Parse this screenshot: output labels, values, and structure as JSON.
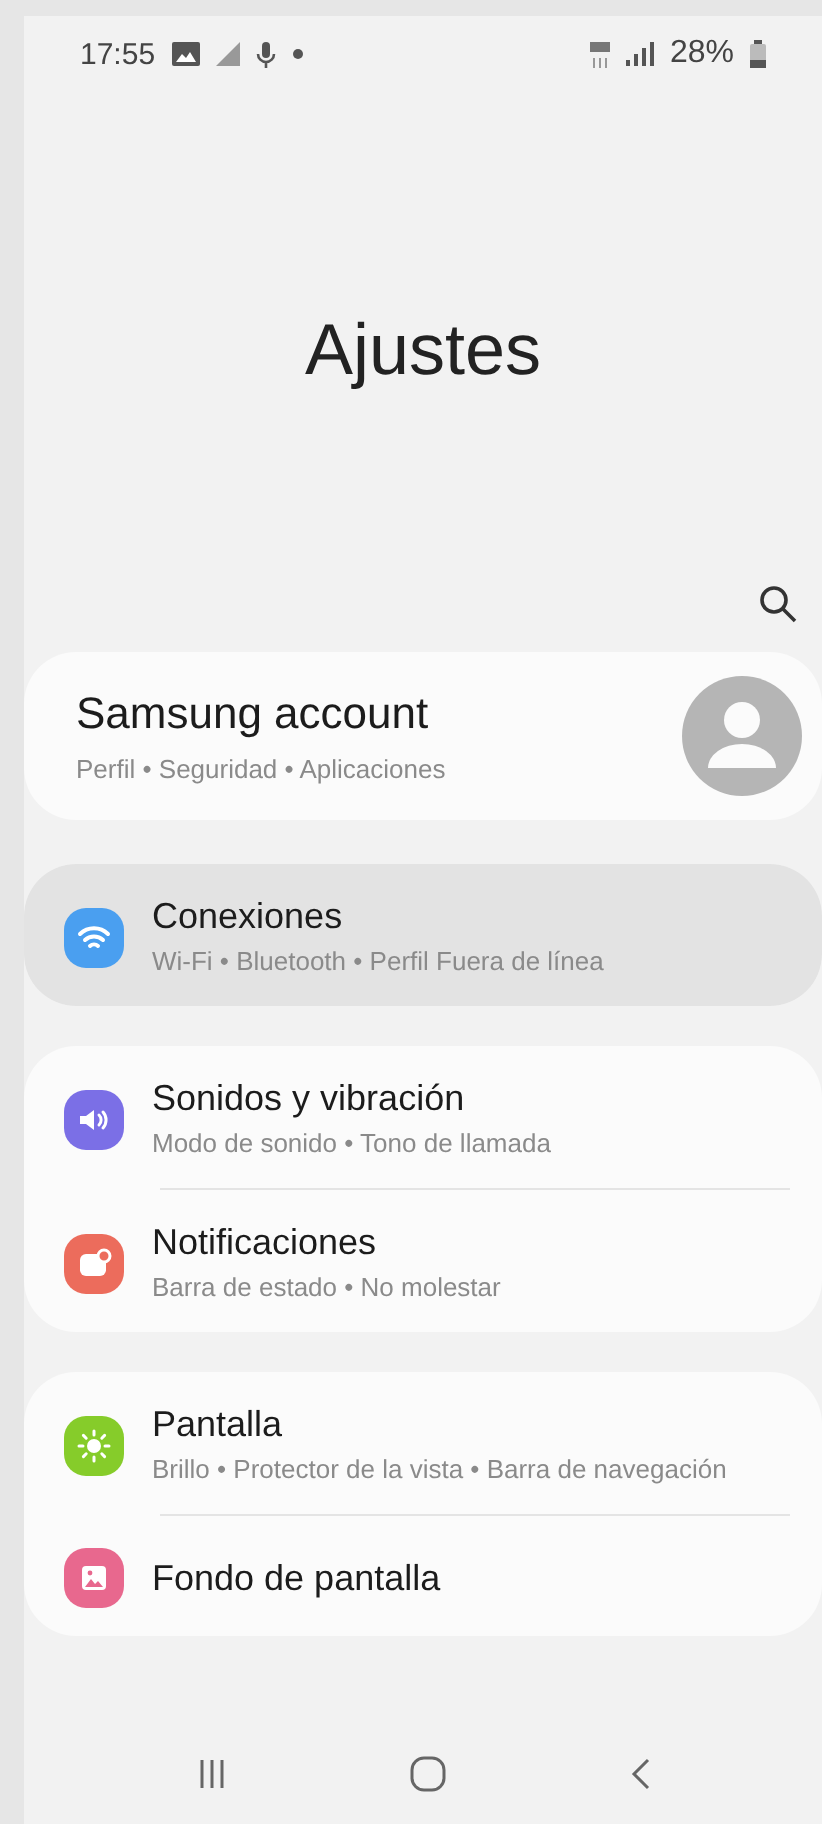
{
  "status_bar": {
    "time": "17:55",
    "battery": "28%"
  },
  "title": "Ajustes",
  "account": {
    "title": "Samsung account",
    "subtitle": "Perfil • Seguridad • Aplicaciones"
  },
  "groups": [
    {
      "items": [
        {
          "kind": "wifi",
          "title": "Conexiones",
          "subtitle": "Wi-Fi • Bluetooth • Perfil Fuera de línea",
          "highlighted": true,
          "color": "#4a9ff0"
        }
      ]
    },
    {
      "items": [
        {
          "kind": "sound",
          "title": "Sonidos y vibración",
          "subtitle": "Modo de sonido • Tono de llamada",
          "highlighted": false,
          "color": "#7b6fe6"
        },
        {
          "kind": "notifications",
          "title": "Notificaciones",
          "subtitle": "Barra de estado • No molestar",
          "highlighted": false,
          "color": "#ec6c5c"
        }
      ]
    },
    {
      "items": [
        {
          "kind": "display",
          "title": "Pantalla",
          "subtitle": "Brillo • Protector de la vista • Barra de navegación",
          "highlighted": false,
          "color": "#86cc2a"
        },
        {
          "kind": "wallpaper",
          "title": "Fondo de pantalla",
          "highlighted": false,
          "color": "#e8688e"
        }
      ]
    }
  ]
}
